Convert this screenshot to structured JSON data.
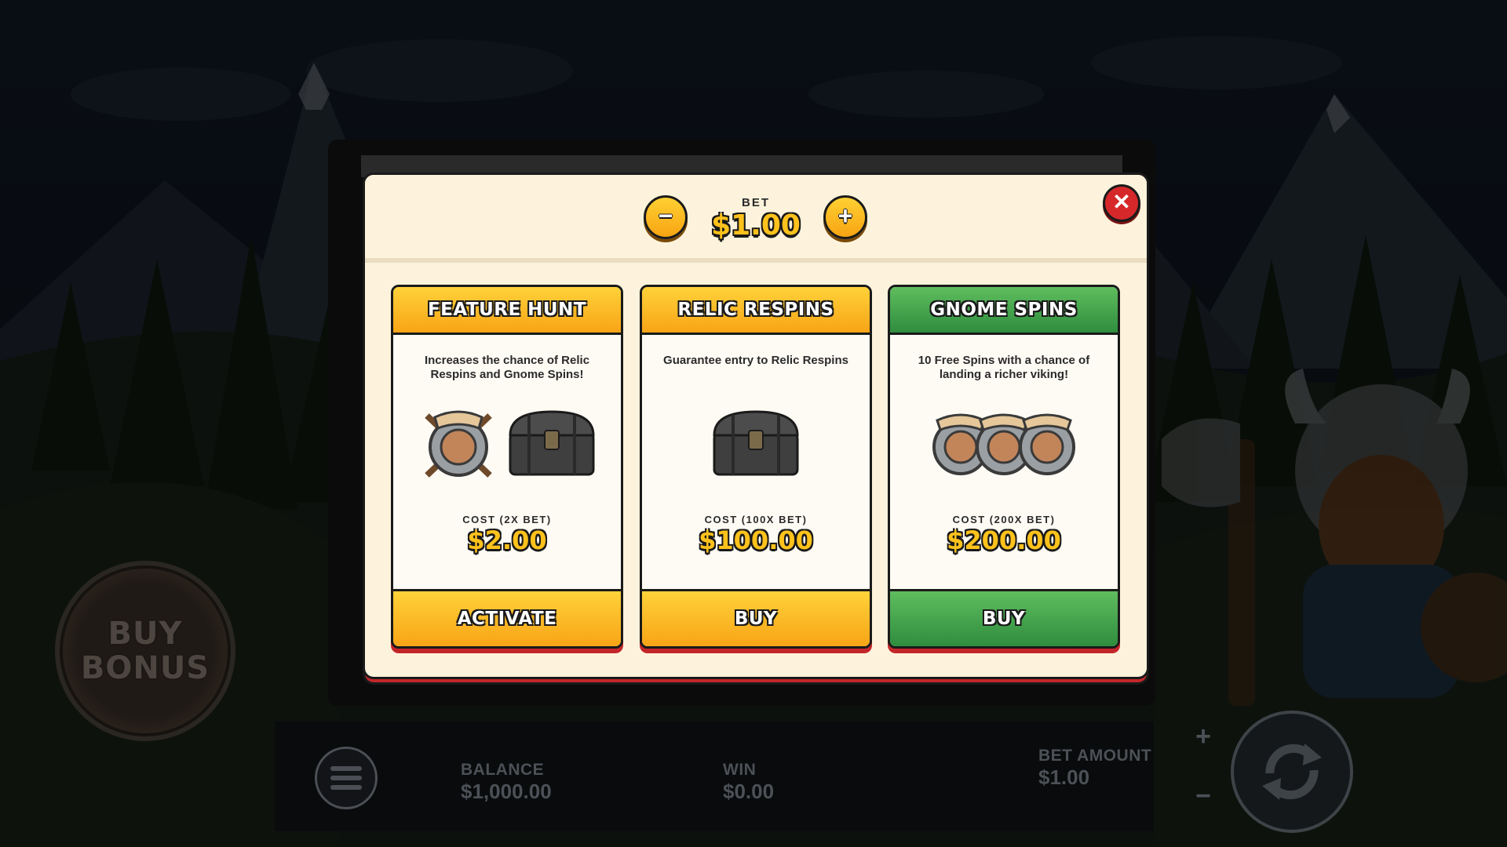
{
  "bet_selector": {
    "label": "BET",
    "value": "$1.00",
    "decrease_symbol": "−",
    "increase_symbol": "+"
  },
  "close_symbol": "✕",
  "cards": [
    {
      "title": "FEATURE HUNT",
      "description": "Increases the chance of Relic Respins and Gnome Spins!",
      "cost_label": "COST (2X BET)",
      "cost_value": "$2.00",
      "button_label": "ACTIVATE",
      "theme": "orange"
    },
    {
      "title": "RELIC RESPINS",
      "description": "Guarantee entry to Relic Respins",
      "cost_label": "COST (100X BET)",
      "cost_value": "$100.00",
      "button_label": "BUY",
      "theme": "orange"
    },
    {
      "title": "GNOME SPINS",
      "description": "10 Free Spins with a chance of landing a richer viking!",
      "cost_label": "COST (200X BET)",
      "cost_value": "$200.00",
      "button_label": "BUY",
      "theme": "green"
    }
  ],
  "buy_bonus": {
    "line1": "BUY",
    "line2": "BONUS"
  },
  "hud": {
    "balance_label": "BALANCE",
    "balance_value": "$1,000.00",
    "win_label": "WIN",
    "win_value": "$0.00",
    "bet_amount_label": "BET AMOUNT",
    "bet_amount_value": "$1.00",
    "bet_up_symbol": "+",
    "bet_down_symbol": "−"
  },
  "colors": {
    "accent_orange": "#f8a416",
    "accent_green": "#2f8d3e",
    "close_red": "#d6282b",
    "panel_cream": "#fdf3dc",
    "gold_text": "#ffc21c"
  }
}
